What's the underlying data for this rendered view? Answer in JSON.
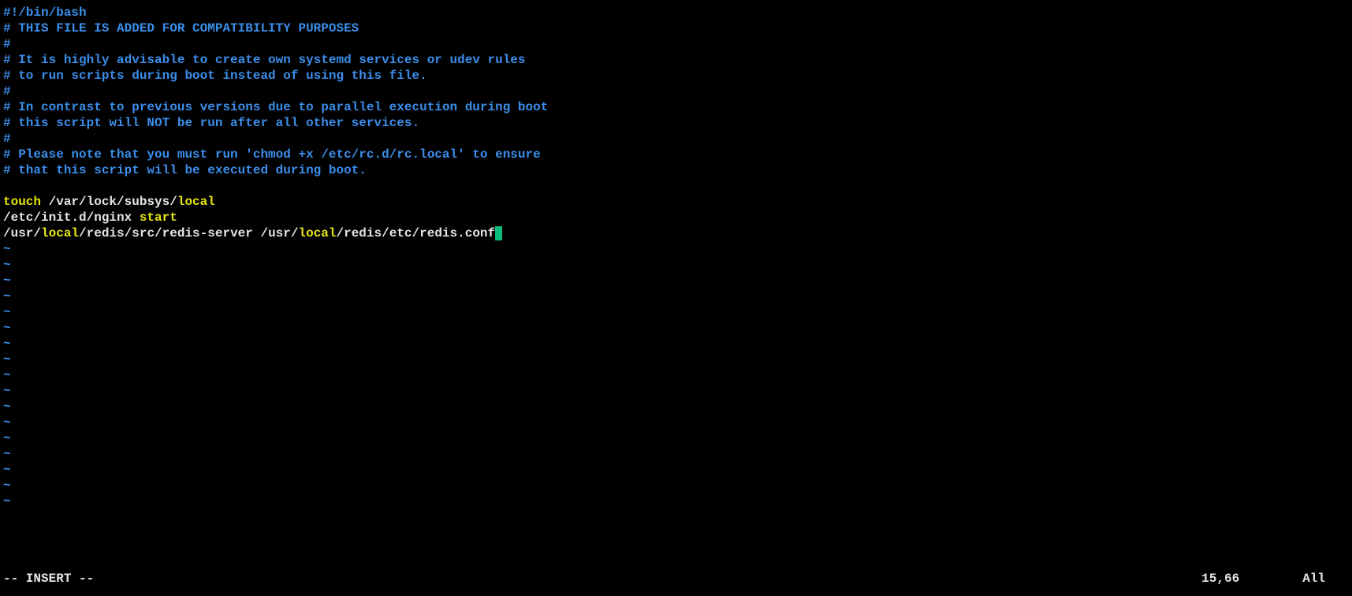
{
  "lines": [
    {
      "segments": [
        {
          "class": "comment",
          "text": "#!/bin/bash"
        }
      ]
    },
    {
      "segments": [
        {
          "class": "comment",
          "text": "# THIS FILE IS ADDED FOR COMPATIBILITY PURPOSES"
        }
      ]
    },
    {
      "segments": [
        {
          "class": "comment",
          "text": "#"
        }
      ]
    },
    {
      "segments": [
        {
          "class": "comment",
          "text": "# It is highly advisable to create own systemd services or udev rules"
        }
      ]
    },
    {
      "segments": [
        {
          "class": "comment",
          "text": "# to run scripts during boot instead of using this file."
        }
      ]
    },
    {
      "segments": [
        {
          "class": "comment",
          "text": "#"
        }
      ]
    },
    {
      "segments": [
        {
          "class": "comment",
          "text": "# In contrast to previous versions due to parallel execution during boot"
        }
      ]
    },
    {
      "segments": [
        {
          "class": "comment",
          "text": "# this script will NOT be run after all other services."
        }
      ]
    },
    {
      "segments": [
        {
          "class": "comment",
          "text": "#"
        }
      ]
    },
    {
      "segments": [
        {
          "class": "comment",
          "text": "# Please note that you must run 'chmod +x /etc/rc.d/rc.local' to ensure"
        }
      ]
    },
    {
      "segments": [
        {
          "class": "comment",
          "text": "# that this script will be executed during boot."
        }
      ]
    },
    {
      "segments": [
        {
          "class": "white",
          "text": ""
        }
      ]
    },
    {
      "segments": [
        {
          "class": "yellow",
          "text": "touch"
        },
        {
          "class": "white",
          "text": " /var/lock/subsys/"
        },
        {
          "class": "yellow",
          "text": "local"
        }
      ]
    },
    {
      "segments": [
        {
          "class": "white",
          "text": "/etc/init.d/nginx "
        },
        {
          "class": "yellow",
          "text": "start"
        }
      ]
    },
    {
      "segments": [
        {
          "class": "white",
          "text": "/usr/"
        },
        {
          "class": "yellow",
          "text": "local"
        },
        {
          "class": "white",
          "text": "/redis/src/redis-server /usr/"
        },
        {
          "class": "yellow",
          "text": "local"
        },
        {
          "class": "white",
          "text": "/redis/etc/redis.conf"
        }
      ],
      "cursor": true
    }
  ],
  "tildeCount": 17,
  "tildeChar": "~",
  "status": {
    "mode": "-- INSERT --",
    "position": "15,66",
    "scroll": "All"
  }
}
